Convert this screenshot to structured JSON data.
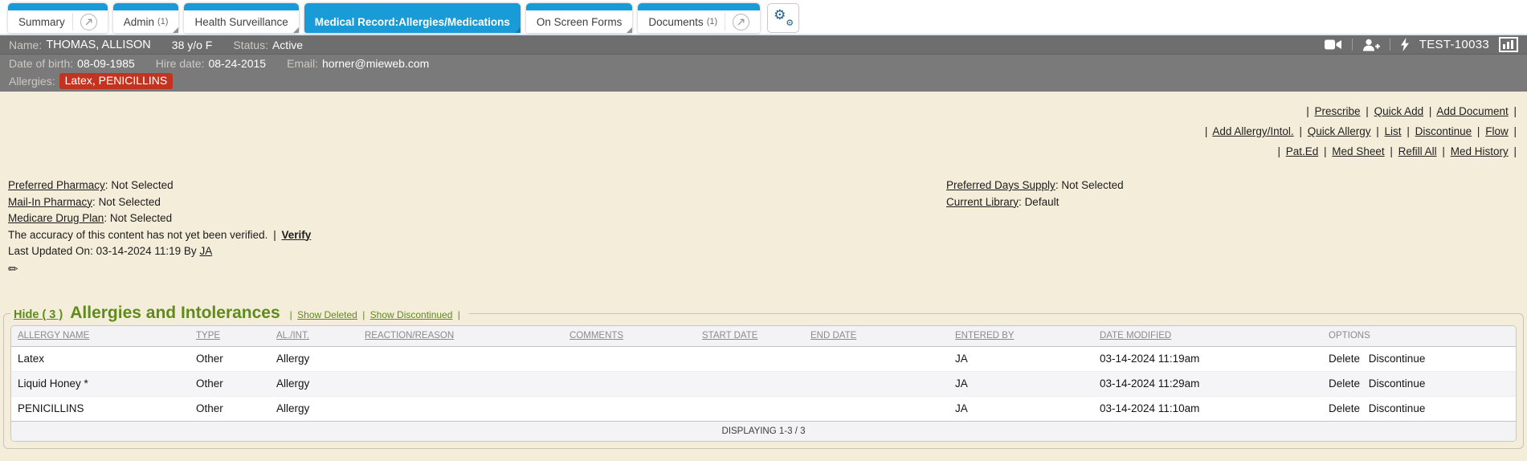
{
  "ui": {
    "pipe": "|",
    "colon": ":",
    "gear_glyph": "⚙",
    "pencil_glyph": "✏"
  },
  "tabs": {
    "summary": {
      "label": "Summary"
    },
    "admin": {
      "label": "Admin",
      "badge": "(1)"
    },
    "health": {
      "label": "Health Surveillance"
    },
    "medical": {
      "label": "Medical Record:Allergies/Medications"
    },
    "forms": {
      "label": "On Screen Forms"
    },
    "documents": {
      "label": "Documents",
      "badge": "(1)"
    }
  },
  "patient": {
    "name_label": "Name:",
    "name": "THOMAS, ALLISON",
    "age_sex": "38 y/o F",
    "status_label": "Status:",
    "status": "Active",
    "chart_id": "TEST-10033",
    "dob_label": "Date of birth:",
    "dob": "08-09-1985",
    "hire_label": "Hire date:",
    "hire": "08-24-2015",
    "email_label": "Email:",
    "email": "horner@mieweb.com",
    "allergies_label": "Allergies:",
    "allergies": "Latex, PENICILLINS"
  },
  "actions": {
    "prescribe": "Prescribe",
    "quick_add": "Quick Add",
    "add_document": "Add Document",
    "add_allergy": "Add Allergy/Intol.",
    "quick_allergy": "Quick Allergy",
    "list": "List",
    "discontinue": "Discontinue",
    "flow": "Flow",
    "pat_ed": "Pat.Ed",
    "med_sheet": "Med Sheet",
    "refill_all": "Refill All",
    "med_history": "Med History"
  },
  "pharmacy": {
    "preferred_label": "Preferred Pharmacy",
    "preferred_value": "Not Selected",
    "mailin_label": "Mail-In Pharmacy",
    "mailin_value": "Not Selected",
    "medicare_label": "Medicare Drug Plan",
    "medicare_value": "Not Selected",
    "accuracy_text": "The accuracy of this content has not yet been verified.",
    "verify_link": "Verify",
    "last_updated": "Last Updated On: 03-14-2024 11:19 By",
    "last_updated_by": "JA",
    "days_supply_label": "Preferred Days Supply",
    "days_supply_value": "Not Selected",
    "library_label": "Current Library",
    "library_value": "Default"
  },
  "allergies_section": {
    "hide_link": "Hide ( 3 )",
    "title": "Allergies and Intolerances",
    "show_deleted": "Show Deleted",
    "show_discontinued": "Show Discontinued",
    "headers": [
      "ALLERGY NAME",
      "TYPE",
      "AL./INT.",
      "REACTION/REASON",
      "COMMENTS",
      "START DATE",
      "END DATE",
      "ENTERED BY",
      "DATE MODIFIED",
      "OPTIONS"
    ],
    "rows": [
      {
        "name": "Latex",
        "type": "Other",
        "alint": "Allergy",
        "reaction": "",
        "comments": "",
        "start": "",
        "end": "",
        "entered": "JA",
        "modified": "03-14-2024 11:19am",
        "delete": "Delete",
        "discontinue": "Discontinue"
      },
      {
        "name": "Liquid Honey *",
        "type": "Other",
        "alint": "Allergy",
        "reaction": "",
        "comments": "",
        "start": "",
        "end": "",
        "entered": "JA",
        "modified": "03-14-2024 11:29am",
        "delete": "Delete",
        "discontinue": "Discontinue"
      },
      {
        "name": "PENICILLINS",
        "type": "Other",
        "alint": "Allergy",
        "reaction": "",
        "comments": "",
        "start": "",
        "end": "",
        "entered": "JA",
        "modified": "03-14-2024 11:10am",
        "delete": "Delete",
        "discontinue": "Discontinue"
      }
    ],
    "footer": "DISPLAYING 1-3 / 3"
  },
  "colors": {
    "accent_blue": "#199bd7",
    "alert_red": "#c2341f",
    "link_green": "#5f8b1d",
    "header_gray": "#6e6e6e"
  }
}
